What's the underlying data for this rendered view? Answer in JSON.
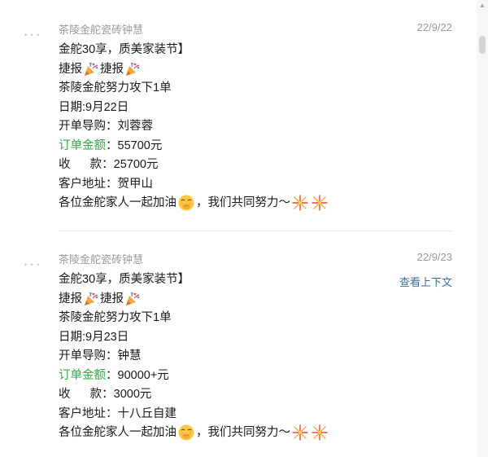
{
  "messages": [
    {
      "sender": "茶陵金舵瓷砖钟慧",
      "date": "22/9/22",
      "lines": {
        "l1": "金舵30享，质美家装节】",
        "l2a": "捷报",
        "l2b": "捷报",
        "l3": "茶陵金舵努力攻下1单",
        "l4": "日期:9月22日",
        "l5": "开单导购：刘蓉蓉",
        "l6a": "订单金额",
        "l6b": "：55700元",
        "l7": "收      款：25700元",
        "l8": "客户地址：贺甲山",
        "l9a": "各位金舵家人一起加油",
        "l9b": "，我们共同努力～"
      }
    },
    {
      "sender": "茶陵金舵瓷砖钟慧",
      "date": "22/9/23",
      "context_link": "查看上下文",
      "lines": {
        "l1": "金舵30享，质美家装节】",
        "l2a": "捷报",
        "l2b": "捷报",
        "l3": "茶陵金舵努力攻下1单",
        "l4": "日期:9月23日",
        "l5": "开单导购：钟慧",
        "l6a": "订单金额",
        "l6b": "：90000+元",
        "l7": "收      款：3000元",
        "l8": "客户地址：十八丘自建",
        "l9a": "各位金舵家人一起加油",
        "l9b": "，我们共同努力～"
      }
    }
  ],
  "icons": {
    "party": "party-popper-icon",
    "face": "hand-over-mouth-face-icon",
    "fireworks": "fireworks-icon"
  },
  "colors": {
    "highlight_green": "#2fae44",
    "meta_gray": "#9a9a9a",
    "link_blue": "#3d6fa3"
  }
}
